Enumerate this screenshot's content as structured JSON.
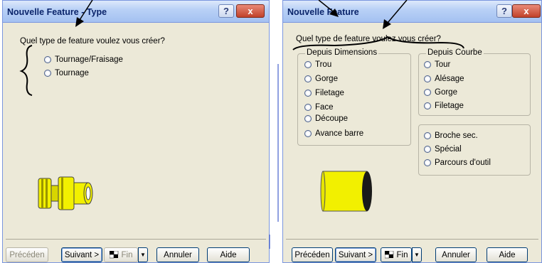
{
  "dialog1": {
    "title": "Nouvelle Feature - Type",
    "question": "Quel type de feature voulez vous créer?",
    "options": [
      "Tournage/Fraisage",
      "Tournage"
    ],
    "buttons": {
      "prev": "Précéden",
      "next": "Suivant >",
      "fin": "Fin",
      "cancel": "Annuler",
      "help": "Aide"
    }
  },
  "dialog2": {
    "title": "Nouvelle Feature",
    "question": "Quel type de feature voulez vous créer?",
    "group_dimensions": {
      "label": "Depuis Dimensions",
      "options": [
        "Trou",
        "Gorge",
        "Filetage",
        "Face",
        "Découpe",
        "Avance barre"
      ]
    },
    "group_courbe": {
      "label": "Depuis Courbe",
      "options": [
        "Tour",
        "Alésage",
        "Gorge",
        "Filetage"
      ]
    },
    "group_other": {
      "options": [
        "Broche sec.",
        "Spécial",
        "Parcours d'outil"
      ]
    },
    "buttons": {
      "prev": "Précéden",
      "next": "Suivant >",
      "fin": "Fin",
      "cancel": "Annuler",
      "help": "Aide"
    }
  },
  "titlebar_buttons": {
    "help": "?",
    "close": "x"
  },
  "colors": {
    "title_text": "#0a246a",
    "dialog_bg": "#ece9d8",
    "part_yellow": "#f2f000"
  }
}
